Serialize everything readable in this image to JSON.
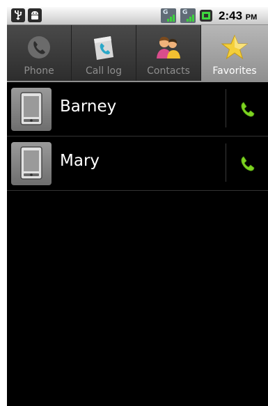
{
  "status_bar": {
    "icons": [
      "usb-icon",
      "android-notification-icon",
      "signal-icon",
      "signal-icon",
      "battery-icon"
    ],
    "network_label": "G",
    "time": "2:43",
    "ampm": "PM"
  },
  "tabs": [
    {
      "label": "Phone",
      "icon": "phone-icon",
      "selected": false
    },
    {
      "label": "Call log",
      "icon": "call-log-icon",
      "selected": false
    },
    {
      "label": "Contacts",
      "icon": "contacts-icon",
      "selected": false
    },
    {
      "label": "Favorites",
      "icon": "star-icon",
      "selected": true
    }
  ],
  "favorites": [
    {
      "name": "Barney",
      "avatar_icon": "phone-device-icon",
      "action_icon": "call-icon"
    },
    {
      "name": "Mary",
      "avatar_icon": "phone-device-icon",
      "action_icon": "call-icon"
    }
  ],
  "colors": {
    "call_green": "#7ed321",
    "background": "#000000",
    "tab_selected": "#a3a3a3"
  }
}
